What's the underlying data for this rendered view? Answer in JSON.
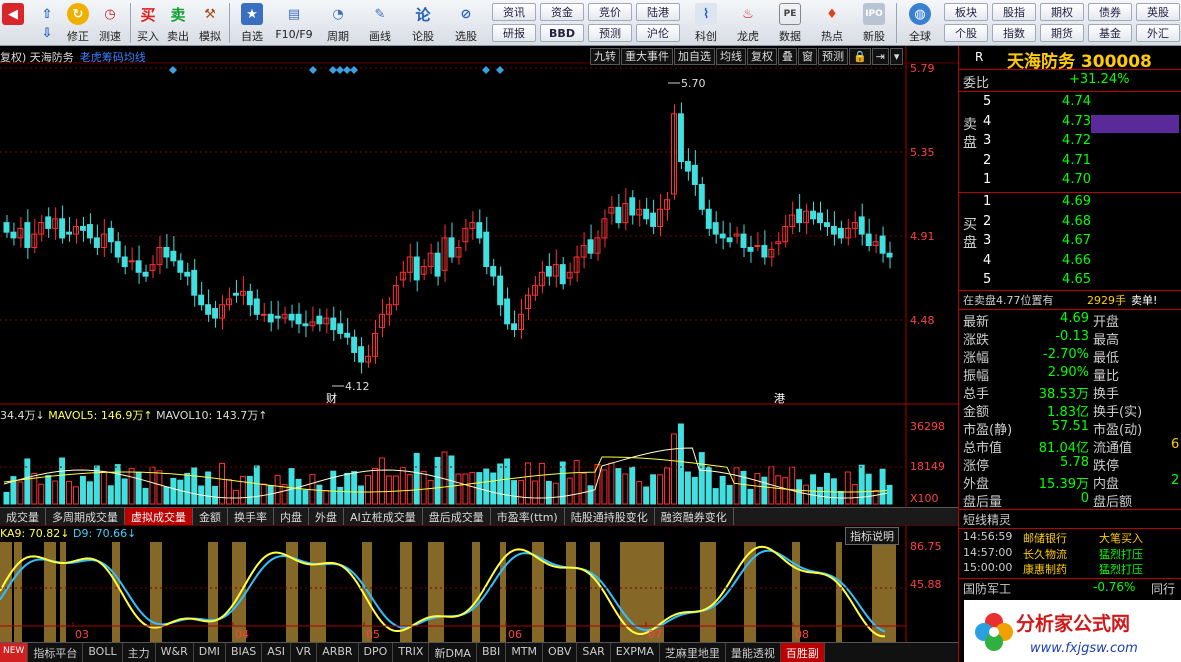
{
  "toolbar": {
    "buttons": [
      "修正",
      "测速",
      "买入",
      "卖出",
      "模拟",
      "自选",
      "F10/F9",
      "周期",
      "画线",
      "论股",
      "选股",
      "科创",
      "龙虎",
      "数据",
      "热点",
      "新股",
      "全球"
    ],
    "menu": [
      "资讯",
      "资金",
      "竞价",
      "陆港",
      "研报",
      "BBD",
      "预测",
      "沪伦",
      "板块",
      "股指",
      "期权",
      "债券",
      "英股",
      "个股",
      "指数",
      "期货",
      "基金",
      "外汇"
    ]
  },
  "chart": {
    "title": "复权) 天海防务",
    "title_sub": "老虎筹码均线",
    "buttons": [
      "九转",
      "重大事件",
      "加自选",
      "均线",
      "复权",
      "叠",
      "窗",
      "预测"
    ],
    "price_axis": [
      "5.79",
      "5.35",
      "4.91",
      "4.48"
    ],
    "high_label": "5.70",
    "low_label": "4.12",
    "marker_cai": "财",
    "marker_gang": "港",
    "vol_header": {
      "a": "34.4万↓",
      "b": "MAVOL5:",
      "c": "146.9万↑",
      "d": "MAVOL10:",
      "e": "143.7万↑"
    },
    "vol_axis": [
      "36298",
      "18149",
      "X100"
    ],
    "panel_tabs": [
      "成交量",
      "多周期成交量",
      "虚拟成交量",
      "金额",
      "换手率",
      "内盘",
      "外盘",
      "AI立桩成交量",
      "盘后成交量",
      "市盈率(ttm)",
      "陆股通持股变化",
      "融资融券变化"
    ],
    "kdj_header": {
      "k": "KA9: 70.82↓",
      "d": "D9: 70.66↓"
    },
    "kdj_button": "指标说明",
    "kdj_axis": [
      "86.75",
      "45.88"
    ],
    "months": [
      "03",
      "04",
      "05",
      "06",
      "07",
      "08"
    ],
    "bottom_tabs": [
      "指标平台",
      "BOLL",
      "主力",
      "W&R",
      "DMI",
      "BIAS",
      "ASI",
      "VR",
      "ARBR",
      "DPO",
      "TRIX",
      "新DMA",
      "BBI",
      "MTM",
      "OBV",
      "SAR",
      "EXPMA",
      "芝麻里地里",
      "量能透视",
      "百胜副"
    ]
  },
  "quote": {
    "r": "R",
    "name": "天海防务 300008",
    "weibi_label": "委比",
    "weibi": "+31.24%",
    "sell_label": "卖盘",
    "buy_label": "买盘",
    "sell": [
      [
        "5",
        "4.74"
      ],
      [
        "4",
        "4.73"
      ],
      [
        "3",
        "4.72"
      ],
      [
        "2",
        "4.71"
      ],
      [
        "1",
        "4.70"
      ]
    ],
    "buy": [
      [
        "1",
        "4.69"
      ],
      [
        "2",
        "4.68"
      ],
      [
        "3",
        "4.67"
      ],
      [
        "4",
        "4.66"
      ],
      [
        "5",
        "4.65"
      ]
    ],
    "sellinfo": "在卖盘4.77位置有",
    "sellinfo_num": "2929手",
    "sellinfo_tail": "卖单!",
    "stats": [
      [
        "最新",
        "4.69",
        "开盘"
      ],
      [
        "涨跌",
        "-0.13",
        "最高"
      ],
      [
        "涨幅",
        "-2.70%",
        "最低"
      ],
      [
        "振幅",
        "2.90%",
        "量比"
      ],
      [
        "总手",
        "38.53万",
        "换手"
      ],
      [
        "金额",
        "1.83亿",
        "换手(实)"
      ],
      [
        "市盈(静)",
        "57.51",
        "市盈(动)"
      ],
      [
        "总市值",
        "81.04亿",
        "流通值"
      ],
      [
        "涨停",
        "5.78",
        "跌停"
      ],
      [
        "外盘",
        "15.39万",
        "内盘"
      ],
      [
        "盘后量",
        "0",
        "盘后额"
      ]
    ],
    "extra": [
      "6",
      "2"
    ],
    "jingling": "短线精灵",
    "feed": [
      [
        "14:56:59",
        "邮储银行",
        "大笔买入"
      ],
      [
        "14:57:00",
        "长久物流",
        "猛烈打压"
      ],
      [
        "15:00:00",
        "康惠制药",
        "猛烈打压"
      ]
    ],
    "sector": "国防军工",
    "sector_val": "-0.76%",
    "sector_tail": "同行"
  },
  "watermark": {
    "name": "分析家公式网",
    "url": "www.fxjgsw.com"
  },
  "colors": {
    "up": "#ff3030",
    "down": "#40e0e0",
    "k": "#ffff40",
    "d": "#30c0ff",
    "band": "#9c7a2e"
  }
}
